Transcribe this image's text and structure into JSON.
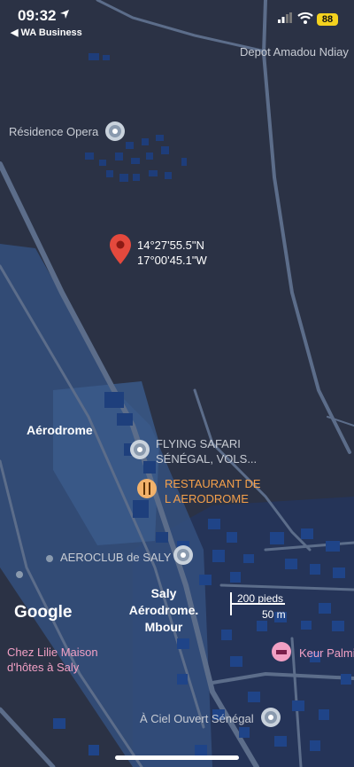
{
  "status_bar": {
    "time": "09:32",
    "back_label": "◀ WA Business",
    "battery": "88",
    "battery_color": "#f4d21e"
  },
  "map": {
    "places": {
      "depot": "Depot Amadou Ndiay",
      "residence": "Résidence Opera",
      "aerodrome": "Aérodrome",
      "flying_safari_1": "FLYING SAFARI",
      "flying_safari_2": "SÉNÉGAL, VOLS...",
      "restaurant_1": "RESTAURANT DE",
      "restaurant_2": "L AERODROME",
      "aeroclub": "AEROCLUB de SALY",
      "saly_1": "Saly",
      "saly_2": "Aérodrome.",
      "saly_3": "Mbour",
      "chez_lilie_1": "Chez Lilie Maison",
      "chez_lilie_2": "d'hôtes à Saly",
      "keur_palmi": "Keur Palmi",
      "ciel_ouvert": "À Ciel Ouvert Sénégal"
    },
    "pin": {
      "lat": "14°27'55.5\"N",
      "lng": "17°00'45.1\"W",
      "color": "#e4493d"
    },
    "scale": {
      "imperial": "200 pieds",
      "metric": "50 m"
    },
    "logo": "Google",
    "colors": {
      "background": "#2b3245",
      "road": "#5a6b86",
      "runway": "#3c5a86",
      "building": "#1c3e7a",
      "accent_orange": "#f5a04a",
      "accent_pink": "#f2a0c4"
    }
  }
}
